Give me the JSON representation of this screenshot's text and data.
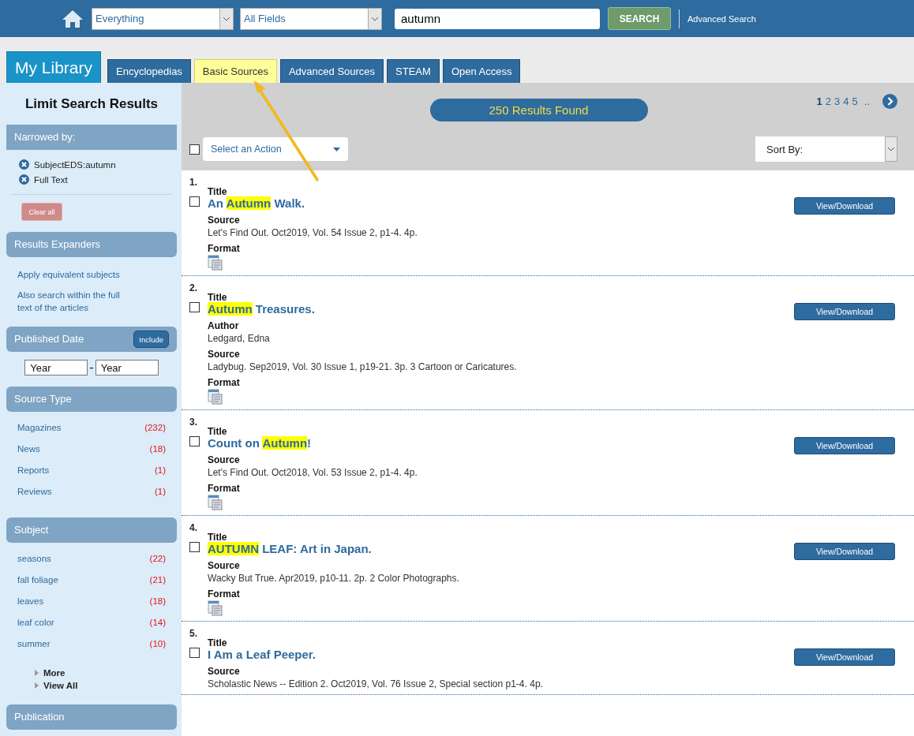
{
  "search_bar": {
    "scope": "Everything",
    "field": "All Fields",
    "query": "autumn",
    "search_button": "SEARCH",
    "advanced_link": "Advanced Search"
  },
  "tabs": [
    {
      "label": "My Library",
      "kind": "home",
      "selected": false
    },
    {
      "label": "Encyclopedias",
      "kind": "tab",
      "selected": false
    },
    {
      "label": "Basic Sources",
      "kind": "tab",
      "selected": true
    },
    {
      "label": "Advanced Sources",
      "kind": "tab",
      "selected": false
    },
    {
      "label": "STEAM",
      "kind": "tab",
      "selected": false
    },
    {
      "label": "Open Access",
      "kind": "tab",
      "selected": false
    }
  ],
  "sidebar": {
    "title": "Limit Search Results",
    "narrowed": {
      "heading": "Narrowed by:",
      "filters": [
        "SubjectEDS:autumn",
        "Full Text"
      ],
      "clear_button": "Clear all"
    },
    "expanders": {
      "heading": "Results Expanders",
      "links": [
        "Apply equivalent subjects",
        "Also search within the full text of the articles"
      ]
    },
    "date": {
      "heading": "Published Date",
      "include_button": "Include",
      "from_placeholder": "Year",
      "separator": "-",
      "to_placeholder": "Year"
    },
    "source_type": {
      "heading": "Source Type",
      "items": [
        {
          "label": "Magazines",
          "count": "(232)"
        },
        {
          "label": "News",
          "count": "(18)"
        },
        {
          "label": "Reports",
          "count": "(1)"
        },
        {
          "label": "Reviews",
          "count": "(1)"
        }
      ]
    },
    "subject": {
      "heading": "Subject",
      "items": [
        {
          "label": "seasons",
          "count": "(22)"
        },
        {
          "label": "fall foliage",
          "count": "(21)"
        },
        {
          "label": "leaves",
          "count": "(18)"
        },
        {
          "label": "leaf color",
          "count": "(14)"
        },
        {
          "label": "summer",
          "count": "(10)"
        }
      ],
      "more_links": [
        "More",
        "View All"
      ]
    },
    "publication": {
      "heading": "Publication"
    }
  },
  "results_header": {
    "count": "250 Results Found",
    "pages": [
      {
        "label": "1",
        "selected": true
      },
      {
        "label": "2",
        "selected": false
      },
      {
        "label": "3",
        "selected": false
      },
      {
        "label": "4",
        "selected": false
      },
      {
        "label": "5",
        "selected": false
      }
    ],
    "ellipsis": "..",
    "select_all_checked": false,
    "action_select": "Select an Action",
    "sort_select": "Sort By:"
  },
  "results": [
    {
      "number": "1.",
      "checked": false,
      "title_label": "Title",
      "title_parts": [
        {
          "text": "An ",
          "highlight": false
        },
        {
          "text": "Autumn",
          "highlight": true
        },
        {
          "text": " Walk.",
          "highlight": false
        }
      ],
      "fields": [
        {
          "label": "Source",
          "value": "Let's Find Out. Oct2019, Vol. 54 Issue 2, p1-4. 4p."
        }
      ],
      "format_label": "Format",
      "button": "View/Download"
    },
    {
      "number": "2.",
      "checked": false,
      "title_label": "Title",
      "title_parts": [
        {
          "text": "Autumn",
          "highlight": true
        },
        {
          "text": " Treasures.",
          "highlight": false
        }
      ],
      "fields": [
        {
          "label": "Author",
          "value": "Ledgard, Edna"
        },
        {
          "label": "Source",
          "value": "Ladybug. Sep2019, Vol. 30 Issue 1, p19-21. 3p. 3 Cartoon or Caricatures."
        }
      ],
      "format_label": "Format",
      "button": "View/Download"
    },
    {
      "number": "3.",
      "checked": false,
      "title_label": "Title",
      "title_parts": [
        {
          "text": "Count on ",
          "highlight": false
        },
        {
          "text": "Autumn",
          "highlight": true
        },
        {
          "text": "!",
          "highlight": false
        }
      ],
      "fields": [
        {
          "label": "Source",
          "value": "Let's Find Out. Oct2018, Vol. 53 Issue 2, p1-4. 4p."
        }
      ],
      "format_label": "Format",
      "button": "View/Download"
    },
    {
      "number": "4.",
      "checked": false,
      "title_label": "Title",
      "title_parts": [
        {
          "text": "AUTUMN",
          "highlight": true
        },
        {
          "text": " LEAF: Art in Japan.",
          "highlight": false
        }
      ],
      "fields": [
        {
          "label": "Source",
          "value": "Wacky But True. Apr2019, p10-11. 2p. 2 Color Photographs."
        }
      ],
      "format_label": "Format",
      "button": "View/Download"
    },
    {
      "number": "5.",
      "checked": false,
      "title_label": "Title",
      "title_parts": [
        {
          "text": "I Am a Leaf Peeper.",
          "highlight": false
        }
      ],
      "fields": [
        {
          "label": "Source",
          "value": "Scholastic News -- Edition 2. Oct2019, Vol. 76 Issue 2, Special section p1-4. 4p."
        }
      ],
      "button": "View/Download"
    }
  ]
}
